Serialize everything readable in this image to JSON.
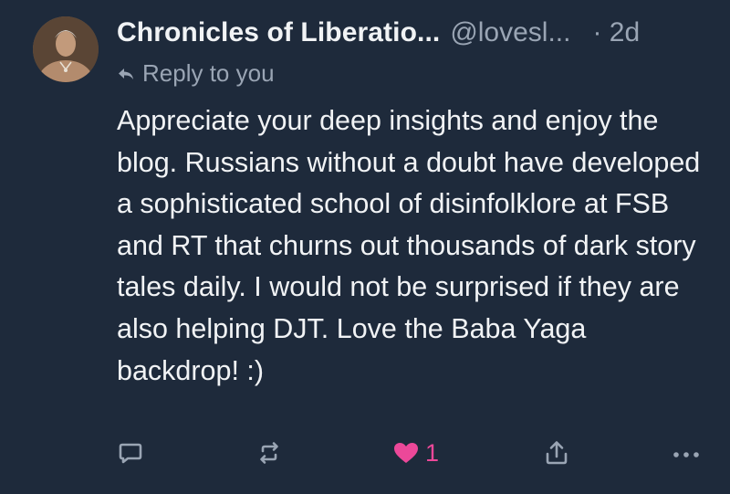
{
  "post": {
    "display_name": "Chronicles of Liberatio...",
    "handle": "@lovesl...",
    "time": "· 2d",
    "reply_label": "Reply to you",
    "body": "Appreciate your deep insights and enjoy the blog. Russians without a doubt have developed a sophisticated school of disinfolklore at FSB and RT that churns out thousands of dark story tales daily. I would not be surprised if they are also helping DJT. Love the Baba Yaga backdrop! :)"
  },
  "actions": {
    "reply_icon": "comment-icon",
    "repost_icon": "repost-icon",
    "like_icon": "heart-icon",
    "like_count": "1",
    "share_icon": "share-icon",
    "more_icon": "more-dots-icon"
  },
  "colors": {
    "background": "#1e2a3b",
    "text": "#f1f3f5",
    "muted": "#9aa5b4",
    "like": "#ec4899"
  }
}
